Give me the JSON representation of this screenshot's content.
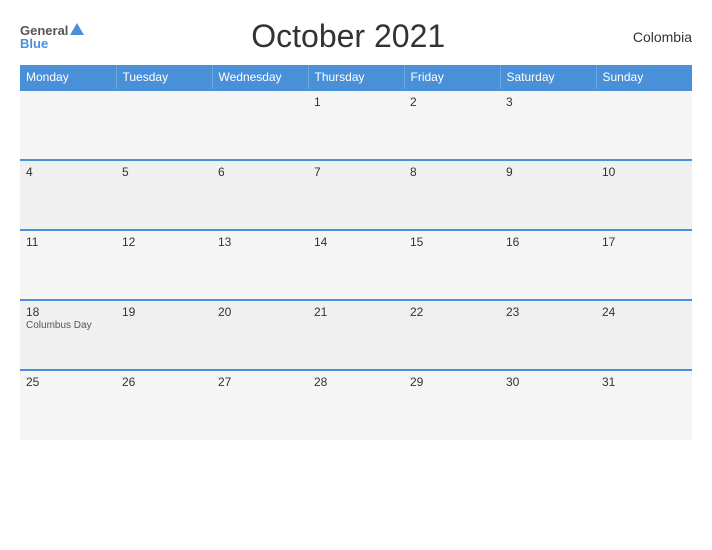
{
  "header": {
    "title": "October 2021",
    "country": "Colombia",
    "logo": {
      "general": "General",
      "blue": "Blue"
    }
  },
  "calendar": {
    "weekdays": [
      "Monday",
      "Tuesday",
      "Wednesday",
      "Thursday",
      "Friday",
      "Saturday",
      "Sunday"
    ],
    "rows": [
      [
        {
          "day": "",
          "event": ""
        },
        {
          "day": "",
          "event": ""
        },
        {
          "day": "",
          "event": ""
        },
        {
          "day": "1",
          "event": ""
        },
        {
          "day": "2",
          "event": ""
        },
        {
          "day": "3",
          "event": ""
        },
        {
          "day": "",
          "event": ""
        }
      ],
      [
        {
          "day": "4",
          "event": ""
        },
        {
          "day": "5",
          "event": ""
        },
        {
          "day": "6",
          "event": ""
        },
        {
          "day": "7",
          "event": ""
        },
        {
          "day": "8",
          "event": ""
        },
        {
          "day": "9",
          "event": ""
        },
        {
          "day": "10",
          "event": ""
        }
      ],
      [
        {
          "day": "11",
          "event": ""
        },
        {
          "day": "12",
          "event": ""
        },
        {
          "day": "13",
          "event": ""
        },
        {
          "day": "14",
          "event": ""
        },
        {
          "day": "15",
          "event": ""
        },
        {
          "day": "16",
          "event": ""
        },
        {
          "day": "17",
          "event": ""
        }
      ],
      [
        {
          "day": "18",
          "event": "Columbus Day"
        },
        {
          "day": "19",
          "event": ""
        },
        {
          "day": "20",
          "event": ""
        },
        {
          "day": "21",
          "event": ""
        },
        {
          "day": "22",
          "event": ""
        },
        {
          "day": "23",
          "event": ""
        },
        {
          "day": "24",
          "event": ""
        }
      ],
      [
        {
          "day": "25",
          "event": ""
        },
        {
          "day": "26",
          "event": ""
        },
        {
          "day": "27",
          "event": ""
        },
        {
          "day": "28",
          "event": ""
        },
        {
          "day": "29",
          "event": ""
        },
        {
          "day": "30",
          "event": ""
        },
        {
          "day": "31",
          "event": ""
        }
      ]
    ]
  }
}
